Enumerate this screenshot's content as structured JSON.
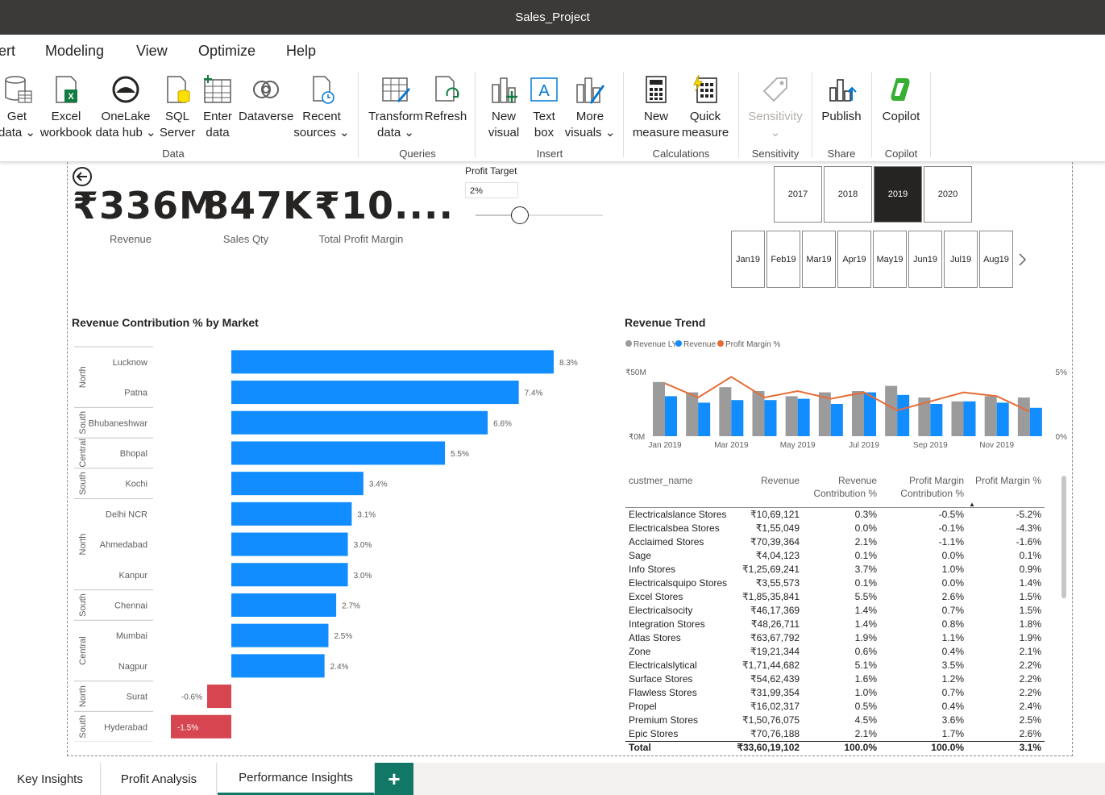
{
  "window": {
    "title": "Sales_Project"
  },
  "menu": [
    "ert",
    "Modeling",
    "View",
    "Optimize",
    "Help"
  ],
  "ribbon": {
    "buttons": [
      {
        "l1": "Get",
        "l2": "data ⌄"
      },
      {
        "l1": "Excel",
        "l2": "workbook"
      },
      {
        "l1": "OneLake",
        "l2": "data hub ⌄"
      },
      {
        "l1": "SQL",
        "l2": "Server"
      },
      {
        "l1": "Enter",
        "l2": "data"
      },
      {
        "l1": "Dataverse",
        "l2": ""
      },
      {
        "l1": "Recent",
        "l2": "sources ⌄"
      },
      {
        "l1": "Transform",
        "l2": "data ⌄"
      },
      {
        "l1": "Refresh",
        "l2": ""
      },
      {
        "l1": "New",
        "l2": "visual"
      },
      {
        "l1": "Text",
        "l2": "box"
      },
      {
        "l1": "More",
        "l2": "visuals ⌄"
      },
      {
        "l1": "New",
        "l2": "measure"
      },
      {
        "l1": "Quick",
        "l2": "measure"
      },
      {
        "l1": "Sensitivity",
        "l2": "⌄"
      },
      {
        "l1": "Publish",
        "l2": ""
      },
      {
        "l1": "Copilot",
        "l2": ""
      }
    ],
    "groups": [
      "Data",
      "Queries",
      "Insert",
      "Calculations",
      "Sensitivity",
      "Share",
      "Copilot"
    ]
  },
  "kpis": [
    {
      "value": "₹336M",
      "label": "Revenue"
    },
    {
      "value": "847K",
      "label": "Sales Qty"
    },
    {
      "value": "₹10....",
      "label": "Total Profit Margin"
    }
  ],
  "profit_target": {
    "title": "Profit Target",
    "value": "2%",
    "level": 0.35
  },
  "years": [
    {
      "label": "2017",
      "selected": false
    },
    {
      "label": "2018",
      "selected": false
    },
    {
      "label": "2019",
      "selected": true
    },
    {
      "label": "2020",
      "selected": false
    }
  ],
  "months": [
    {
      "m": "Jan",
      "y": "19"
    },
    {
      "m": "Feb",
      "y": "19"
    },
    {
      "m": "Mar",
      "y": "19"
    },
    {
      "m": "Apr",
      "y": "19"
    },
    {
      "m": "May",
      "y": "19"
    },
    {
      "m": "Jun",
      "y": "19"
    },
    {
      "m": "Jul",
      "y": "19"
    },
    {
      "m": "Aug",
      "y": "19"
    }
  ],
  "colors": {
    "blue": "#118dff",
    "red": "#d64550",
    "gray": "#9b9b9b",
    "orange": "#e66c37",
    "teal": "#117865"
  },
  "chart_data": [
    {
      "type": "bar",
      "title": "Revenue Contribution % by Market",
      "orientation": "horizontal",
      "categories": [
        "Lucknow",
        "Patna",
        "Bhubaneshwar",
        "Bhopal",
        "Kochi",
        "Delhi NCR",
        "Ahmedabad",
        "Kanpur",
        "Chennai",
        "Mumbai",
        "Nagpur",
        "Surat",
        "Hyderabad"
      ],
      "values": [
        8.3,
        7.4,
        6.6,
        5.5,
        3.4,
        3.1,
        3.0,
        3.0,
        2.7,
        2.5,
        2.4,
        -0.6,
        -1.5
      ],
      "data_labels": [
        "8.3%",
        "7.4%",
        "6.6%",
        "5.5%",
        "3.4%",
        "3.1%",
        "3.0%",
        "3.0%",
        "2.7%",
        "2.5%",
        "2.4%",
        "-0.6%",
        "-1.5%"
      ],
      "groups": [
        {
          "label": "North",
          "start": 0,
          "end": 1
        },
        {
          "label": "South",
          "start": 2,
          "end": 2
        },
        {
          "label": "Central",
          "start": 3,
          "end": 3
        },
        {
          "label": "South",
          "start": 4,
          "end": 4
        },
        {
          "label": "North",
          "start": 5,
          "end": 7
        },
        {
          "label": "South",
          "start": 8,
          "end": 8
        },
        {
          "label": "Central",
          "start": 9,
          "end": 10
        },
        {
          "label": "North",
          "start": 11,
          "end": 11
        },
        {
          "label": "South",
          "start": 12,
          "end": 12
        }
      ],
      "xlim": [
        -1.5,
        8.3
      ]
    },
    {
      "type": "bar",
      "title": "Revenue Trend",
      "legend": [
        "Revenue LY",
        "Revenue",
        "Profit Margin %"
      ],
      "legend_placement": "top-left",
      "x_tick_labels": [
        "Jan 2019",
        "Mar 2019",
        "May 2019",
        "Jul 2019",
        "Sep 2019",
        "Nov 2019"
      ],
      "y_tick_labels": [
        "₹0M",
        "₹50M"
      ],
      "y2_tick_labels": [
        "0%",
        "5%"
      ],
      "ylim": [
        0,
        50
      ],
      "y2lim": [
        0,
        5
      ],
      "categories": [
        "Jan",
        "Feb",
        "Mar",
        "Apr",
        "May",
        "Jun",
        "Jul",
        "Aug",
        "Sep",
        "Oct",
        "Nov",
        "Dec"
      ],
      "series": [
        {
          "name": "Revenue LY",
          "type": "bar",
          "values": [
            42,
            34,
            38,
            35,
            31,
            34,
            35,
            39,
            30,
            27,
            31,
            30
          ]
        },
        {
          "name": "Revenue",
          "type": "bar",
          "values": [
            31,
            26,
            28,
            28,
            29,
            25,
            34,
            32,
            25,
            27,
            26,
            22
          ]
        },
        {
          "name": "Profit Margin %",
          "type": "line",
          "values": [
            4.1,
            3.0,
            4.6,
            3.0,
            3.5,
            2.9,
            3.4,
            2.0,
            2.7,
            3.4,
            3.1,
            1.9
          ]
        }
      ]
    }
  ],
  "table": {
    "headers": [
      "custmer_name",
      "Revenue",
      "Revenue Contribution %",
      "Profit Margin Contribution %",
      "Profit Margin %"
    ],
    "rows": [
      [
        "Electricalslance Stores",
        "₹10,69,121",
        "0.3%",
        "-0.5%",
        "-5.2%"
      ],
      [
        "Electricalsbea Stores",
        "₹1,55,049",
        "0.0%",
        "-0.1%",
        "-4.3%"
      ],
      [
        "Acclaimed Stores",
        "₹70,39,364",
        "2.1%",
        "-1.1%",
        "-1.6%"
      ],
      [
        "Sage",
        "₹4,04,123",
        "0.1%",
        "0.0%",
        "0.1%"
      ],
      [
        "Info Stores",
        "₹1,25,69,241",
        "3.7%",
        "1.0%",
        "0.9%"
      ],
      [
        "Electricalsquipo Stores",
        "₹3,55,573",
        "0.1%",
        "0.0%",
        "1.4%"
      ],
      [
        "Excel Stores",
        "₹1,85,35,841",
        "5.5%",
        "2.6%",
        "1.5%"
      ],
      [
        "Electricalsocity",
        "₹46,17,369",
        "1.4%",
        "0.7%",
        "1.5%"
      ],
      [
        "Integration Stores",
        "₹48,26,711",
        "1.4%",
        "0.8%",
        "1.8%"
      ],
      [
        "Atlas Stores",
        "₹63,67,792",
        "1.9%",
        "1.1%",
        "1.9%"
      ],
      [
        "Zone",
        "₹19,21,344",
        "0.6%",
        "0.4%",
        "2.1%"
      ],
      [
        "Electricalslytical",
        "₹1,71,44,682",
        "5.1%",
        "3.5%",
        "2.2%"
      ],
      [
        "Surface Stores",
        "₹54,62,439",
        "1.6%",
        "1.2%",
        "2.2%"
      ],
      [
        "Flawless Stores",
        "₹31,99,354",
        "1.0%",
        "0.7%",
        "2.2%"
      ],
      [
        "Propel",
        "₹16,02,317",
        "0.5%",
        "0.4%",
        "2.4%"
      ],
      [
        "Premium Stores",
        "₹1,50,76,075",
        "4.5%",
        "3.6%",
        "2.5%"
      ],
      [
        "Epic Stores",
        "₹70,76,188",
        "2.1%",
        "1.7%",
        "2.6%"
      ]
    ],
    "total": [
      "Total",
      "₹33,60,19,102",
      "100.0%",
      "100.0%",
      "3.1%"
    ]
  },
  "tabs": [
    {
      "label": "Key Insights",
      "active": false
    },
    {
      "label": "Profit Analysis",
      "active": false
    },
    {
      "label": "Performance Insights",
      "active": true
    }
  ],
  "add_tab_label": "+"
}
